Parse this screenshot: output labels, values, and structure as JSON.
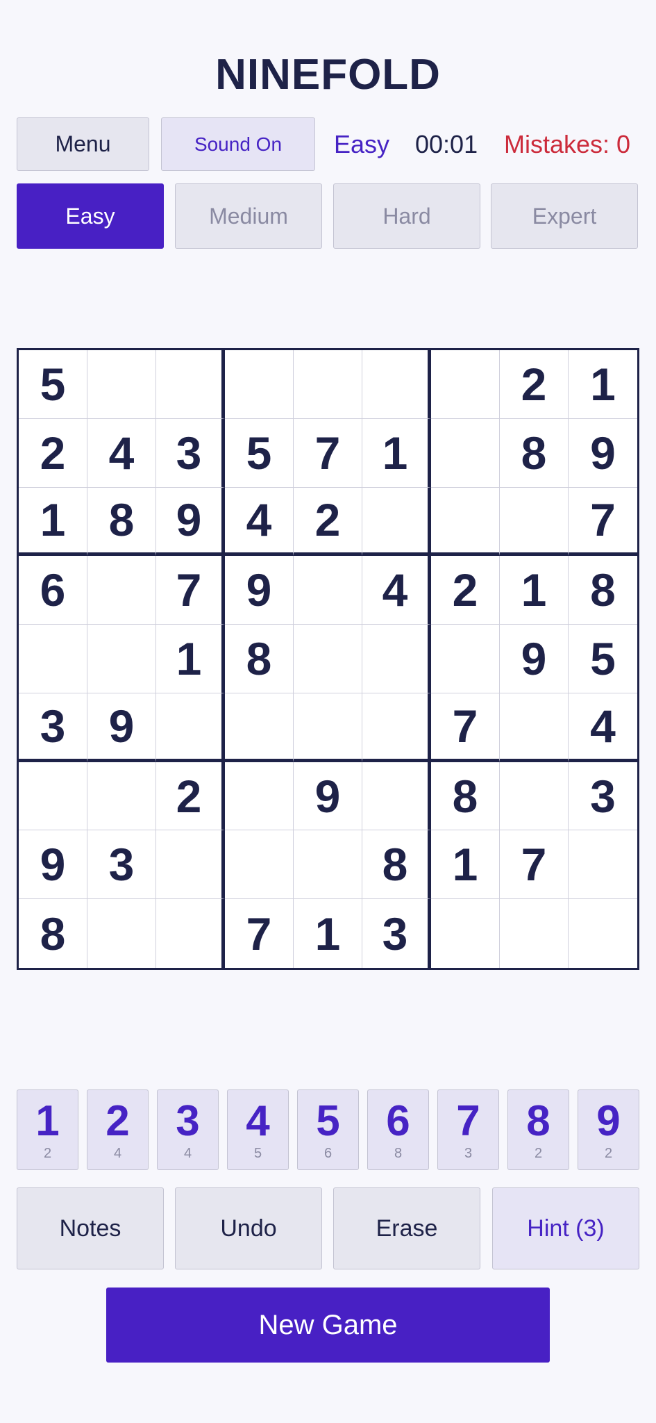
{
  "app": {
    "title": "NINEFOLD"
  },
  "toolbar": {
    "menu_label": "Menu",
    "sound_label": "Sound On",
    "difficulty": "Easy",
    "timer": "00:01",
    "mistakes": "Mistakes: 0"
  },
  "difficulty_tabs": [
    {
      "label": "Easy",
      "active": true
    },
    {
      "label": "Medium",
      "active": false
    },
    {
      "label": "Hard",
      "active": false
    },
    {
      "label": "Expert",
      "active": false
    }
  ],
  "board": {
    "rows": [
      [
        "5",
        "",
        "",
        "",
        "",
        "",
        "",
        "2",
        "1"
      ],
      [
        "2",
        "4",
        "3",
        "5",
        "7",
        "1",
        "",
        "8",
        "9"
      ],
      [
        "1",
        "8",
        "9",
        "4",
        "2",
        "",
        "",
        "",
        "7"
      ],
      [
        "6",
        "",
        "7",
        "9",
        "",
        "4",
        "2",
        "1",
        "8"
      ],
      [
        "",
        "",
        "1",
        "8",
        "",
        "",
        "",
        "9",
        "5"
      ],
      [
        "3",
        "9",
        "",
        "",
        "",
        "",
        "7",
        "",
        "4"
      ],
      [
        "",
        "",
        "2",
        "",
        "9",
        "",
        "8",
        "",
        "3"
      ],
      [
        "9",
        "3",
        "",
        "",
        "",
        "8",
        "1",
        "7",
        ""
      ],
      [
        "8",
        "",
        "",
        "7",
        "1",
        "3",
        "",
        "",
        ""
      ]
    ]
  },
  "number_pad": [
    {
      "digit": "1",
      "remaining": "2"
    },
    {
      "digit": "2",
      "remaining": "4"
    },
    {
      "digit": "3",
      "remaining": "4"
    },
    {
      "digit": "4",
      "remaining": "5"
    },
    {
      "digit": "5",
      "remaining": "6"
    },
    {
      "digit": "6",
      "remaining": "8"
    },
    {
      "digit": "7",
      "remaining": "3"
    },
    {
      "digit": "8",
      "remaining": "2"
    },
    {
      "digit": "9",
      "remaining": "2"
    }
  ],
  "actions": {
    "notes": "Notes",
    "undo": "Undo",
    "erase": "Erase",
    "hint": "Hint (3)"
  },
  "new_game_label": "New Game",
  "colors": {
    "accent": "#4820c4",
    "text": "#1e2248",
    "error": "#cc2b3b",
    "background": "#f7f7fc"
  }
}
